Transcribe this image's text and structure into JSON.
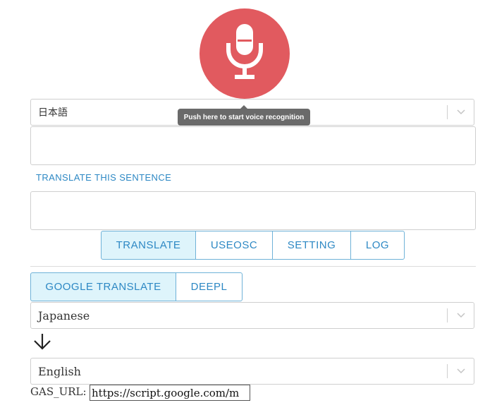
{
  "mic": {
    "tooltip": "Push here to start voice recognition",
    "color": "#e15a5f",
    "icon": "microphone-icon"
  },
  "source_language": {
    "value": "日本語"
  },
  "translate_sentence_link": "TRANSLATE THIS SENTENCE",
  "mode_tabs": [
    {
      "label": "TRANSLATE",
      "active": true
    },
    {
      "label": "USEOSC",
      "active": false
    },
    {
      "label": "SETTING",
      "active": false
    },
    {
      "label": "LOG",
      "active": false
    }
  ],
  "engine_tabs": [
    {
      "label": "GOOGLE TRANSLATE",
      "active": true
    },
    {
      "label": "DEEPL",
      "active": false
    }
  ],
  "from_language": {
    "value": "Japanese"
  },
  "arrow_icon": "arrow-down-icon",
  "to_language": {
    "value": "English"
  },
  "gas_url": {
    "label": "GAS_URL:",
    "value": "https://script.google.com/m"
  },
  "colors": {
    "accent": "#2d88c4",
    "active_tab_bg": "#def4fb",
    "tab_border": "#6fb2d8"
  }
}
